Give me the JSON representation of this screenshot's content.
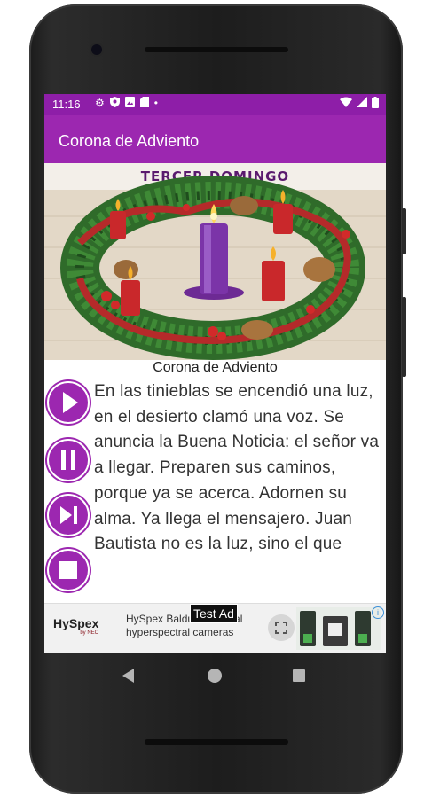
{
  "status_bar": {
    "time": "11:16",
    "left_icons": [
      "gear-icon",
      "shield-icon",
      "image-icon",
      "sim-card-icon",
      "dot-icon"
    ],
    "right_icons": [
      "wifi-icon",
      "signal-icon",
      "battery-icon"
    ]
  },
  "app_bar": {
    "title": "Corona de Adviento"
  },
  "hero": {
    "banner": "TERCER DOMINGO",
    "image": "advent-wreath-image"
  },
  "caption": "Corona de Adviento",
  "verse": "En las tinieblas se encendió una luz, en el desierto clamó una voz. Se anuncia la Buena Noticia: el señor va a llegar. Preparen sus caminos, porque ya se acerca. Adornen su alma. Ya llega el mensajero. Juan Bautista no es la luz, sino el que",
  "controls": [
    {
      "name": "play",
      "icon": "play-icon"
    },
    {
      "name": "pause",
      "icon": "pause-icon"
    },
    {
      "name": "next",
      "icon": "skip-next-icon"
    },
    {
      "name": "stop",
      "icon": "stop-icon"
    }
  ],
  "ad": {
    "brand": "HySpex",
    "brand_sub": "by NEO",
    "text": "HySpex Baldur industrial hyperspectral cameras",
    "badge": "Test Ad",
    "info": "i"
  },
  "colors": {
    "status_bar": "#8e1ea8",
    "app_bar": "#9c27b0",
    "control": "#9c27b0"
  }
}
